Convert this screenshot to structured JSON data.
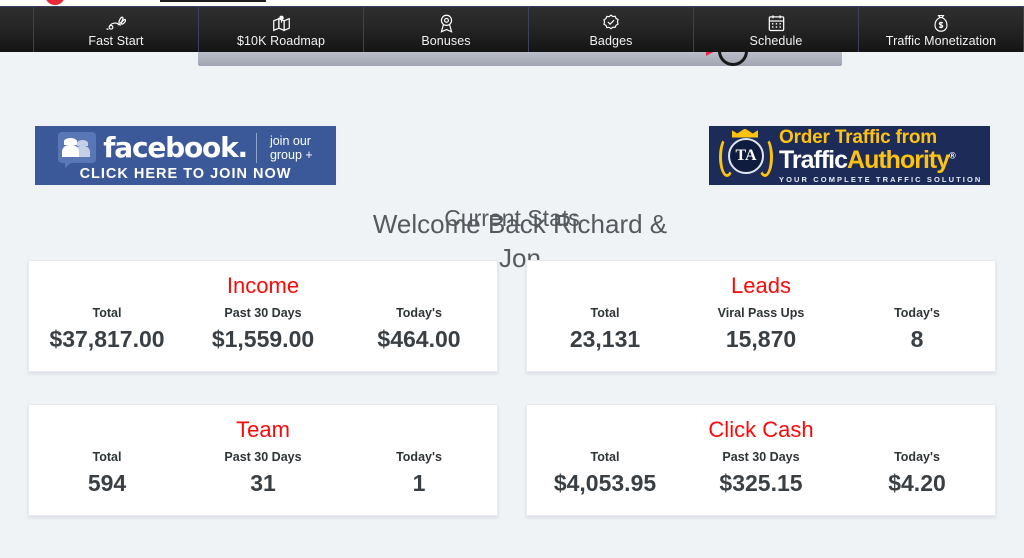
{
  "nav": {
    "items": [
      {
        "label": "Fast Start",
        "icon": "rabbit-icon"
      },
      {
        "label": "$10K Roadmap",
        "icon": "map-pin-icon"
      },
      {
        "label": "Bonuses",
        "icon": "award-ribbon-icon"
      },
      {
        "label": "Badges",
        "icon": "check-seal-icon"
      },
      {
        "label": "Schedule",
        "icon": "calendar-icon"
      },
      {
        "label": "Traffic Monetization",
        "icon": "money-bag-icon"
      }
    ]
  },
  "video": {
    "play_icon": "youtube-play-icon"
  },
  "banners": {
    "facebook": {
      "brand": "facebook.",
      "join_line1": "join our",
      "join_line2": "group +",
      "cta": "CLICK HERE TO JOIN NOW",
      "icon": "facebook-group-icon",
      "bg_color": "#3b5998"
    },
    "traffic_authority": {
      "line1": "Order Traffic from",
      "line2_white": "Traffic",
      "line2_yellow": "Authority",
      "registered_mark": "®",
      "tagline": "YOUR COMPLETE TRAFFIC SOLUTION",
      "seal_text": "TA",
      "icon": "laurel-seal-icon",
      "bg_color": "#1d2b59",
      "accent_color": "#ffc20e"
    }
  },
  "header": {
    "welcome": "Welcome Back Richard & Jon",
    "section_title": "Current Stats"
  },
  "stats": {
    "title_color": "#fb0a0a",
    "cards": [
      {
        "title": "Income",
        "columns": [
          {
            "label": "Total",
            "value": "$37,817.00"
          },
          {
            "label": "Past 30 Days",
            "value": "$1,559.00"
          },
          {
            "label": "Today's",
            "value": "$464.00"
          }
        ]
      },
      {
        "title": "Leads",
        "columns": [
          {
            "label": "Total",
            "value": "23,131"
          },
          {
            "label": "Viral Pass Ups",
            "value": "15,870"
          },
          {
            "label": "Today's",
            "value": "8"
          }
        ]
      },
      {
        "title": "Team",
        "columns": [
          {
            "label": "Total",
            "value": "594"
          },
          {
            "label": "Past 30 Days",
            "value": "31"
          },
          {
            "label": "Today's",
            "value": "1"
          }
        ]
      },
      {
        "title": "Click Cash",
        "columns": [
          {
            "label": "Total",
            "value": "$4,053.95"
          },
          {
            "label": "Past 30 Days",
            "value": "$325.15"
          },
          {
            "label": "Today's",
            "value": "$4.20"
          }
        ]
      }
    ]
  }
}
